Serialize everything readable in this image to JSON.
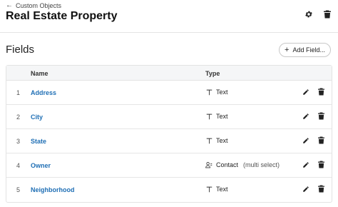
{
  "header": {
    "back_label": "Custom Objects",
    "title": "Real Estate Property"
  },
  "section": {
    "title": "Fields",
    "add_button": "Add Field..."
  },
  "table": {
    "columns": {
      "name": "Name",
      "type": "Type"
    },
    "rows": [
      {
        "num": "1",
        "name": "Address",
        "type": "Text",
        "type_sub": "",
        "type_icon": "text-icon"
      },
      {
        "num": "2",
        "name": "City",
        "type": "Text",
        "type_sub": "",
        "type_icon": "text-icon"
      },
      {
        "num": "3",
        "name": "State",
        "type": "Text",
        "type_sub": "",
        "type_icon": "text-icon"
      },
      {
        "num": "4",
        "name": "Owner",
        "type": "Contact",
        "type_sub": "(multi select)",
        "type_icon": "contact-icon"
      },
      {
        "num": "5",
        "name": "Neighborhood",
        "type": "Text",
        "type_sub": "",
        "type_icon": "text-icon"
      }
    ]
  },
  "colors": {
    "link": "#1f6fb5",
    "header_bg": "#f5f6f7",
    "border": "#e3e3e3"
  }
}
